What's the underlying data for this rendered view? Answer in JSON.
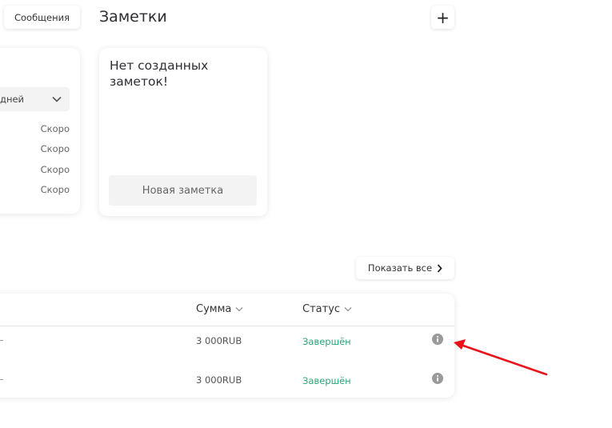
{
  "header": {
    "messages_label": "Сообщения",
    "notes_title": "Заметки",
    "add_label": "+"
  },
  "left_card": {
    "period_value": "дней",
    "rows": [
      "Скоро",
      "Скоро",
      "Скоро",
      "Скоро"
    ]
  },
  "notes": {
    "empty_text": "Нет созданных заметок!",
    "new_note_label": "Новая заметка"
  },
  "transactions": {
    "show_all_label": "Показать все",
    "columns": {
      "sum": "Сумма",
      "status": "Статус"
    },
    "rows": [
      {
        "sum": "3 000RUB",
        "status": "Завершён"
      },
      {
        "sum": "3 000RUB",
        "status": "Завершён"
      }
    ]
  },
  "colors": {
    "status_done": "#2fa779",
    "annotation_arrow": "#e8141a"
  }
}
